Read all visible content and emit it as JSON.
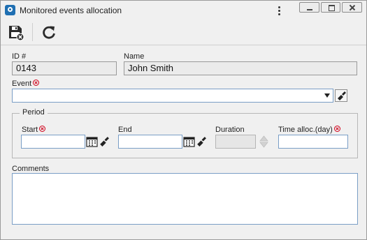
{
  "window": {
    "title": "Monitored events allocation",
    "icon": "app-logo-icon",
    "controls": [
      "more-options-icon",
      "minimize-icon",
      "restore-icon",
      "close-icon"
    ]
  },
  "toolbar": {
    "buttons": [
      {
        "name": "save-and-close-button",
        "icon": "save-close-icon"
      },
      {
        "name": "refresh-button",
        "icon": "refresh-icon"
      }
    ]
  },
  "form": {
    "id": {
      "label": "ID #",
      "value": "0143"
    },
    "name": {
      "label": "Name",
      "value": "John Smith"
    },
    "event": {
      "label": "Event",
      "value": "",
      "required": true
    },
    "period": {
      "legend": "Period",
      "start": {
        "label": "Start",
        "value": "",
        "required": true
      },
      "end": {
        "label": "End",
        "value": ""
      },
      "duration": {
        "label": "Duration",
        "value": ""
      },
      "time_alloc": {
        "label": "Time alloc.(day)",
        "value": "",
        "required": true
      }
    },
    "comments": {
      "label": "Comments",
      "value": ""
    }
  },
  "colors": {
    "field_border": "#7a9ec6",
    "required_marker": "#d0021b",
    "background": "#f0f0f0"
  }
}
